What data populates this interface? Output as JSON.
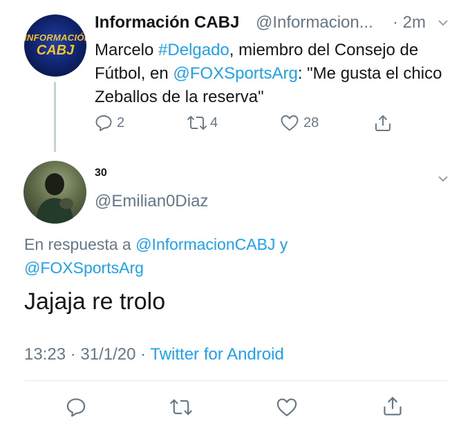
{
  "colors": {
    "accent": "#1da1f2",
    "secondary_text": "#657786",
    "primary_text": "#14171a",
    "divider": "#e1e8ed"
  },
  "original_tweet": {
    "avatar_text_line1": "INFORMACIÓN",
    "avatar_text_line2": "CABJ",
    "display_name": "Información CABJ",
    "handle": "@Informacion...",
    "time": "· 2m",
    "text_parts": [
      "Marcelo ",
      "#Delgado",
      ", miembro del Consejo de Fútbol, en ",
      "@FOXSportsArg",
      ": \"Me gusta el chico Zeballos de la reserva\""
    ],
    "reply_count": "2",
    "retweet_count": "4",
    "like_count": "28"
  },
  "reply_tweet": {
    "display_name": "30",
    "handle": "@Emilian0Diaz",
    "reply_prefix": "En respuesta a ",
    "reply_to_1": "@InformacionCABJ",
    "reply_joiner": " y",
    "reply_to_2": "@FOXSportsArg",
    "text": "Jajaja re trolo",
    "time": "13:23 · 31/1/20 · ",
    "source": "Twitter for Android"
  },
  "icons": [
    "reply-icon",
    "retweet-icon",
    "like-icon",
    "share-icon",
    "chevron-down-icon"
  ]
}
